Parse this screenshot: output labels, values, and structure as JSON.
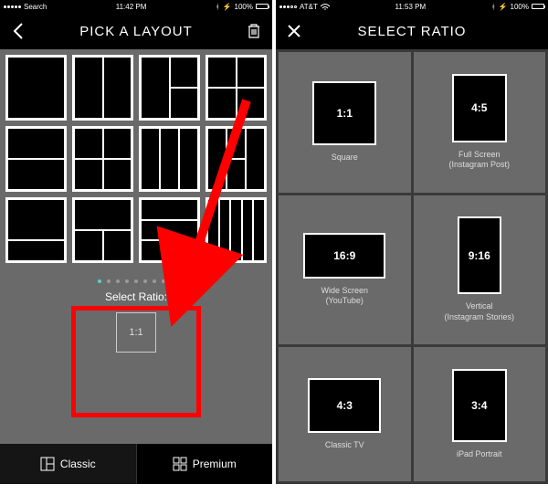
{
  "left": {
    "status": {
      "carrier": "Search",
      "time": "11:42 PM",
      "battery": "100%"
    },
    "header": {
      "title": "PICK A LAYOUT"
    },
    "pager": {
      "count": 9,
      "active": 0
    },
    "ratio": {
      "label": "Select Ratio:",
      "value": "1:1"
    },
    "tabs": {
      "classic": "Classic",
      "premium": "Premium"
    }
  },
  "right": {
    "status": {
      "carrier": "AT&T",
      "time": "11:53 PM",
      "battery": "100%"
    },
    "header": {
      "title": "SELECT RATIO"
    },
    "ratios": [
      {
        "ratio": "1:1",
        "name": "Square",
        "sub": "",
        "w": 70,
        "h": 70
      },
      {
        "ratio": "4:5",
        "name": "Full Screen",
        "sub": "(Instagram Post)",
        "w": 60,
        "h": 75
      },
      {
        "ratio": "16:9",
        "name": "Wide Screen",
        "sub": "(YouTube)",
        "w": 90,
        "h": 50
      },
      {
        "ratio": "9:16",
        "name": "Vertical",
        "sub": "(Instagram Stories)",
        "w": 48,
        "h": 85
      },
      {
        "ratio": "4:3",
        "name": "Classic TV",
        "sub": "",
        "w": 80,
        "h": 60
      },
      {
        "ratio": "3:4",
        "name": "iPad Portrait",
        "sub": "",
        "w": 60,
        "h": 80
      }
    ]
  }
}
